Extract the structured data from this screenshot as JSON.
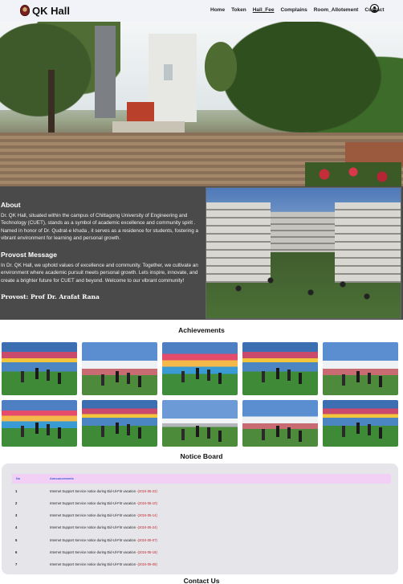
{
  "nav": {
    "brand": "QK Hall",
    "links": [
      "Home",
      "Token",
      "Hall_Fee",
      "Complains",
      "Room_Allotement",
      "Contact"
    ]
  },
  "about": {
    "heading": "About",
    "text": "Dr. QK Hall, situated within the campus of Chittagong University of Engineering and Technology (CUET), stands as a symbol of academic excellence and community spirit . Named in honor of Dr. Qudrat-e khuda , it serves as a residence for students, fostering a vibrant environment for learning and personal growth.",
    "provost_heading": "Provost Message",
    "provost_text": "In Dr. QK Hall, we uphold values of excellence and community. Together, we cultivate an environment where academic pursuit meets personal growth. Lets inspire, innovate, and create a brighter future for CUET and beyond. Welcome to our vibrant community!",
    "provost_name": "Provost: Prof Dr. Arafat Rana"
  },
  "achievements": {
    "title": "Achievements"
  },
  "notice_board": {
    "title": "Notice Board",
    "columns": [
      "No",
      "Announcements"
    ],
    "rows": [
      {
        "no": "1",
        "text": "Internet Support Service notice during Eid-Ul-Fitr vacation -",
        "date": "(2024-05-22)"
      },
      {
        "no": "2",
        "text": "Internet Support Service notice during Eid-Ul-Fitr vacation -",
        "date": "(2024-05-10)"
      },
      {
        "no": "3",
        "text": "Internet Support Service notice during Eid-Ul-Fitr vacation -",
        "date": "(2024-05-14)"
      },
      {
        "no": "4",
        "text": "Internet Support Service notice during Eid-Ul-Fitr vacation -",
        "date": "(2024-05-24)"
      },
      {
        "no": "5",
        "text": "Internet Support Service notice during Eid-Ul-Fitr vacation -",
        "date": "(2024-05-07)"
      },
      {
        "no": "6",
        "text": "Internet Support Service notice during Eid-Ul-Fitr vacation -",
        "date": "(2024-05-18)"
      },
      {
        "no": "7",
        "text": "Internet Support Service notice during Eid-Ul-Fitr vacation -",
        "date": "(2024-05-08)"
      }
    ]
  },
  "contact": {
    "title": "Contact Us"
  },
  "icons": {
    "logo": "hall-logo-icon",
    "user": "user-account-icon"
  },
  "colors": {
    "nav_bg": "#f2f3f9",
    "about_bg": "#4a4a4b",
    "notice_header_bg": "#f2cff4",
    "notice_header_text": "#3f5ad6",
    "notice_date": "#c0252d",
    "notice_bg": "#e6e6ea"
  }
}
